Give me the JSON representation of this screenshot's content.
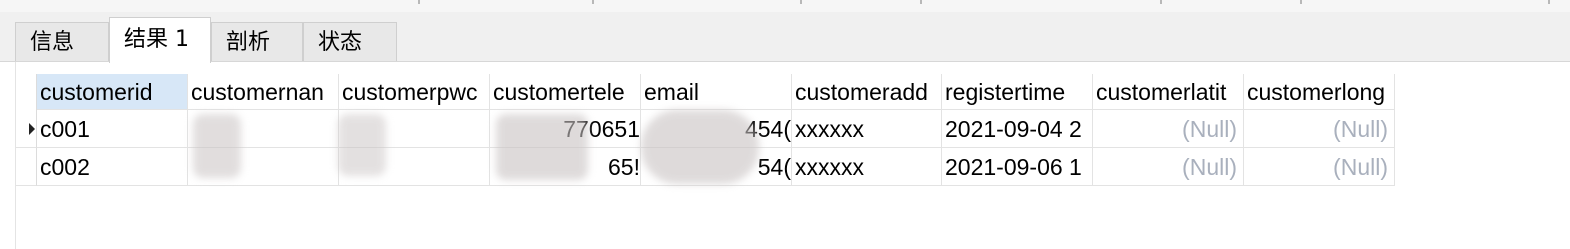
{
  "tabs": [
    "信息",
    "结果 1",
    "剖析",
    "状态"
  ],
  "active_tab": "结果 1",
  "columns": [
    "customerid",
    "customernan",
    "customerpwc",
    "customertele",
    "email",
    "customeradd",
    "registertime",
    "customerlatit",
    "customerlong"
  ],
  "rows": [
    [
      "c001",
      "",
      "",
      "770651",
      "454(",
      "xxxxxx",
      "2021-09-04 2",
      "(Null)",
      "(Null)"
    ],
    [
      "c002",
      "",
      "",
      "65!",
      "54(",
      "xxxxxx",
      "2021-09-06 1",
      "(Null)",
      "(Null)"
    ]
  ]
}
